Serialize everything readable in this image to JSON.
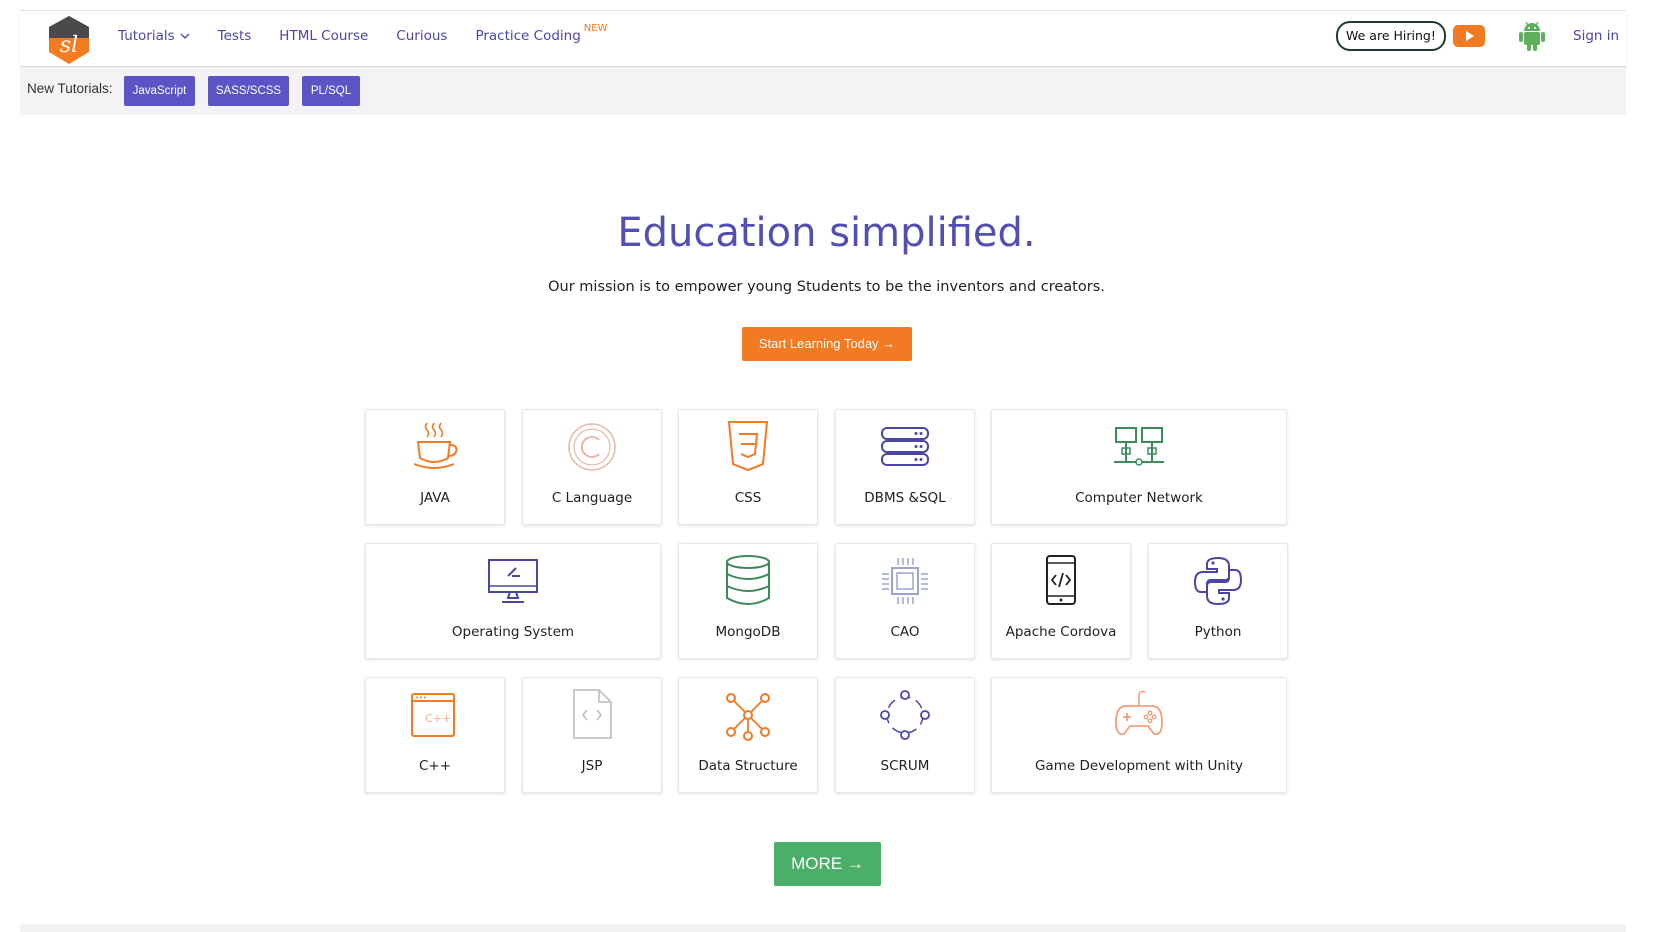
{
  "header": {
    "logo_text": "sl",
    "logo_icon": "studytonight-logo-icon",
    "nav": [
      {
        "label": "Tutorials",
        "has_dropdown": true
      },
      {
        "label": "Tests"
      },
      {
        "label": "HTML Course"
      },
      {
        "label": "Curious"
      },
      {
        "label": "Practice Coding",
        "badge": "NEW"
      }
    ],
    "hiring_label": "We are Hiring!",
    "youtube_icon": "youtube-icon",
    "android_icon": "android-icon",
    "sign_in": "Sign in"
  },
  "new_tutorials": {
    "label": "New Tutorials:",
    "chips": [
      "JavaScript",
      "SASS/SCSS",
      "PL/SQL"
    ]
  },
  "hero": {
    "title": "Education simplified.",
    "subtitle": "Our mission is to empower young Students to be the inventors and creators.",
    "cta": "Start Learning Today →"
  },
  "courses": [
    {
      "label": "JAVA",
      "icon": "coffee-cup-icon"
    },
    {
      "label": "C Language",
      "icon": "c-circle-icon"
    },
    {
      "label": "CSS",
      "icon": "css3-shield-icon"
    },
    {
      "label": "DBMS &SQL",
      "icon": "server-stack-icon"
    },
    {
      "label": "Computer Network",
      "icon": "network-icon"
    },
    {
      "label": "Operating System",
      "icon": "desktop-monitor-icon"
    },
    {
      "label": "MongoDB",
      "icon": "database-icon"
    },
    {
      "label": "CAO",
      "icon": "cpu-chip-icon"
    },
    {
      "label": "Apache Cordova",
      "icon": "mobile-code-icon"
    },
    {
      "label": "Python",
      "icon": "python-icon"
    },
    {
      "label": "C++",
      "icon": "cpp-window-icon"
    },
    {
      "label": "JSP",
      "icon": "code-file-icon"
    },
    {
      "label": "Data Structure",
      "icon": "node-graph-icon"
    },
    {
      "label": "SCRUM",
      "icon": "team-cycle-icon"
    },
    {
      "label": "Game Development with Unity",
      "icon": "gamepad-icon"
    }
  ],
  "more_label": "MORE →",
  "colors": {
    "brand_purple": "#514fb0",
    "chip_purple": "#5b54c4",
    "cta_orange": "#f17a22",
    "more_green": "#4caf67"
  }
}
